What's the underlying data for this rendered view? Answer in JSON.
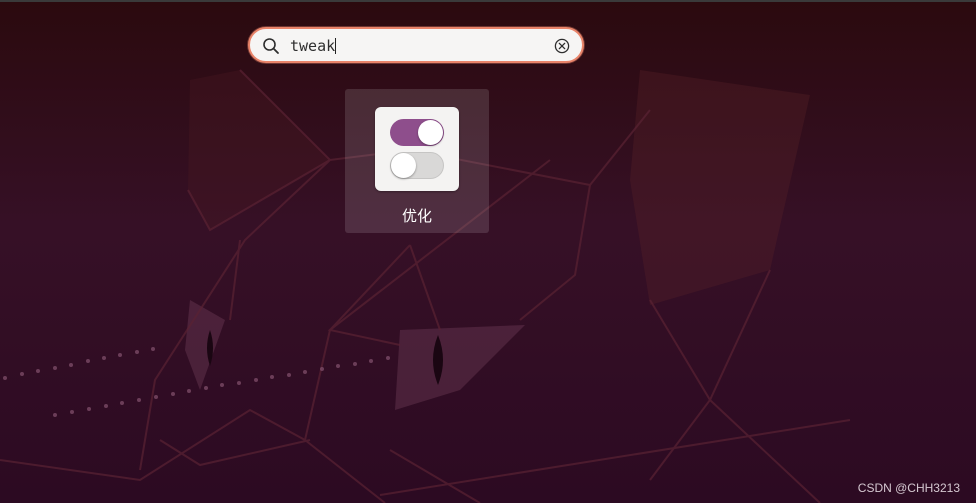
{
  "search": {
    "query": "tweak",
    "icon": "search-icon",
    "clear_icon": "clear-icon"
  },
  "results": [
    {
      "label": "优化",
      "icon": "toggle-switches-icon"
    }
  ],
  "watermark": "CSDN @CHH3213",
  "colors": {
    "search_border": "#e9846a",
    "toggle_on": "#8e4e8c",
    "toggle_off": "#d9d8d7",
    "tile_bg": "rgba(255,255,255,0.13)"
  }
}
